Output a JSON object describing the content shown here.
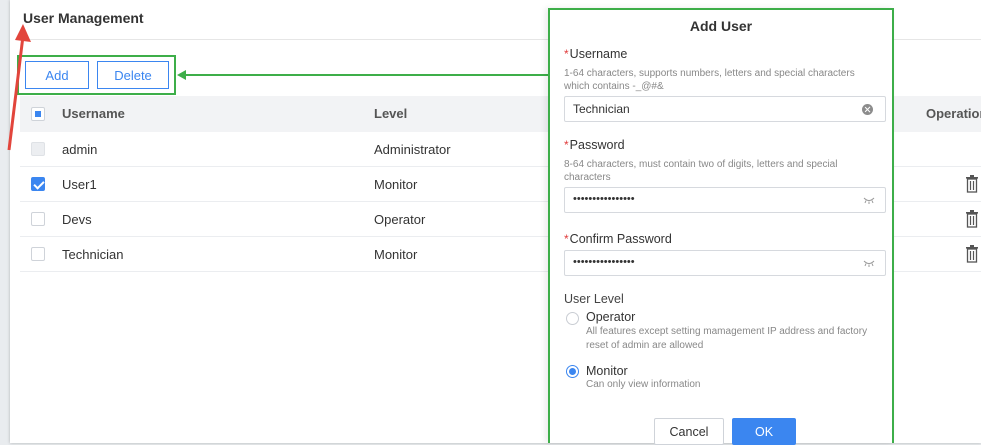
{
  "page": {
    "title": "User Management"
  },
  "toolbar": {
    "add_label": "Add",
    "delete_label": "Delete"
  },
  "table": {
    "columns": {
      "username": "Username",
      "level": "Level",
      "operations": "Operations"
    },
    "rows": [
      {
        "username": "admin",
        "level": "Administrator",
        "checked": false,
        "disabled": true
      },
      {
        "username": "User1",
        "level": "Monitor",
        "checked": true,
        "disabled": false
      },
      {
        "username": "Devs",
        "level": "Operator",
        "checked": false,
        "disabled": false
      },
      {
        "username": "Technician",
        "level": "Monitor",
        "checked": false,
        "disabled": false
      }
    ]
  },
  "dialog": {
    "title": "Add User",
    "required_mark": "*",
    "username": {
      "label": "Username",
      "hint": "1-64 characters, supports numbers, letters and special characters which contains -_@#&",
      "value": "Technician"
    },
    "password": {
      "label": "Password",
      "hint": "8-64 characters, must contain two of digits, letters and special characters",
      "value": "••••••••••••••••"
    },
    "confirm_password": {
      "label": "Confirm Password",
      "value": "••••••••••••••••"
    },
    "user_level": {
      "label": "User Level",
      "options": [
        {
          "title": "Operator",
          "desc": "All features except setting mamagement IP address and factory reset of admin are allowed",
          "selected": false
        },
        {
          "title": "Monitor",
          "desc": "Can only view information",
          "selected": true
        }
      ]
    },
    "cancel_label": "Cancel",
    "ok_label": "OK"
  },
  "colors": {
    "accent": "#3b86f0",
    "highlight": "#3dae49",
    "annotation_arrow": "#e2453c",
    "required": "#e03b3b"
  },
  "icons": [
    "trash-icon",
    "clear-icon",
    "eye-closed-icon"
  ]
}
